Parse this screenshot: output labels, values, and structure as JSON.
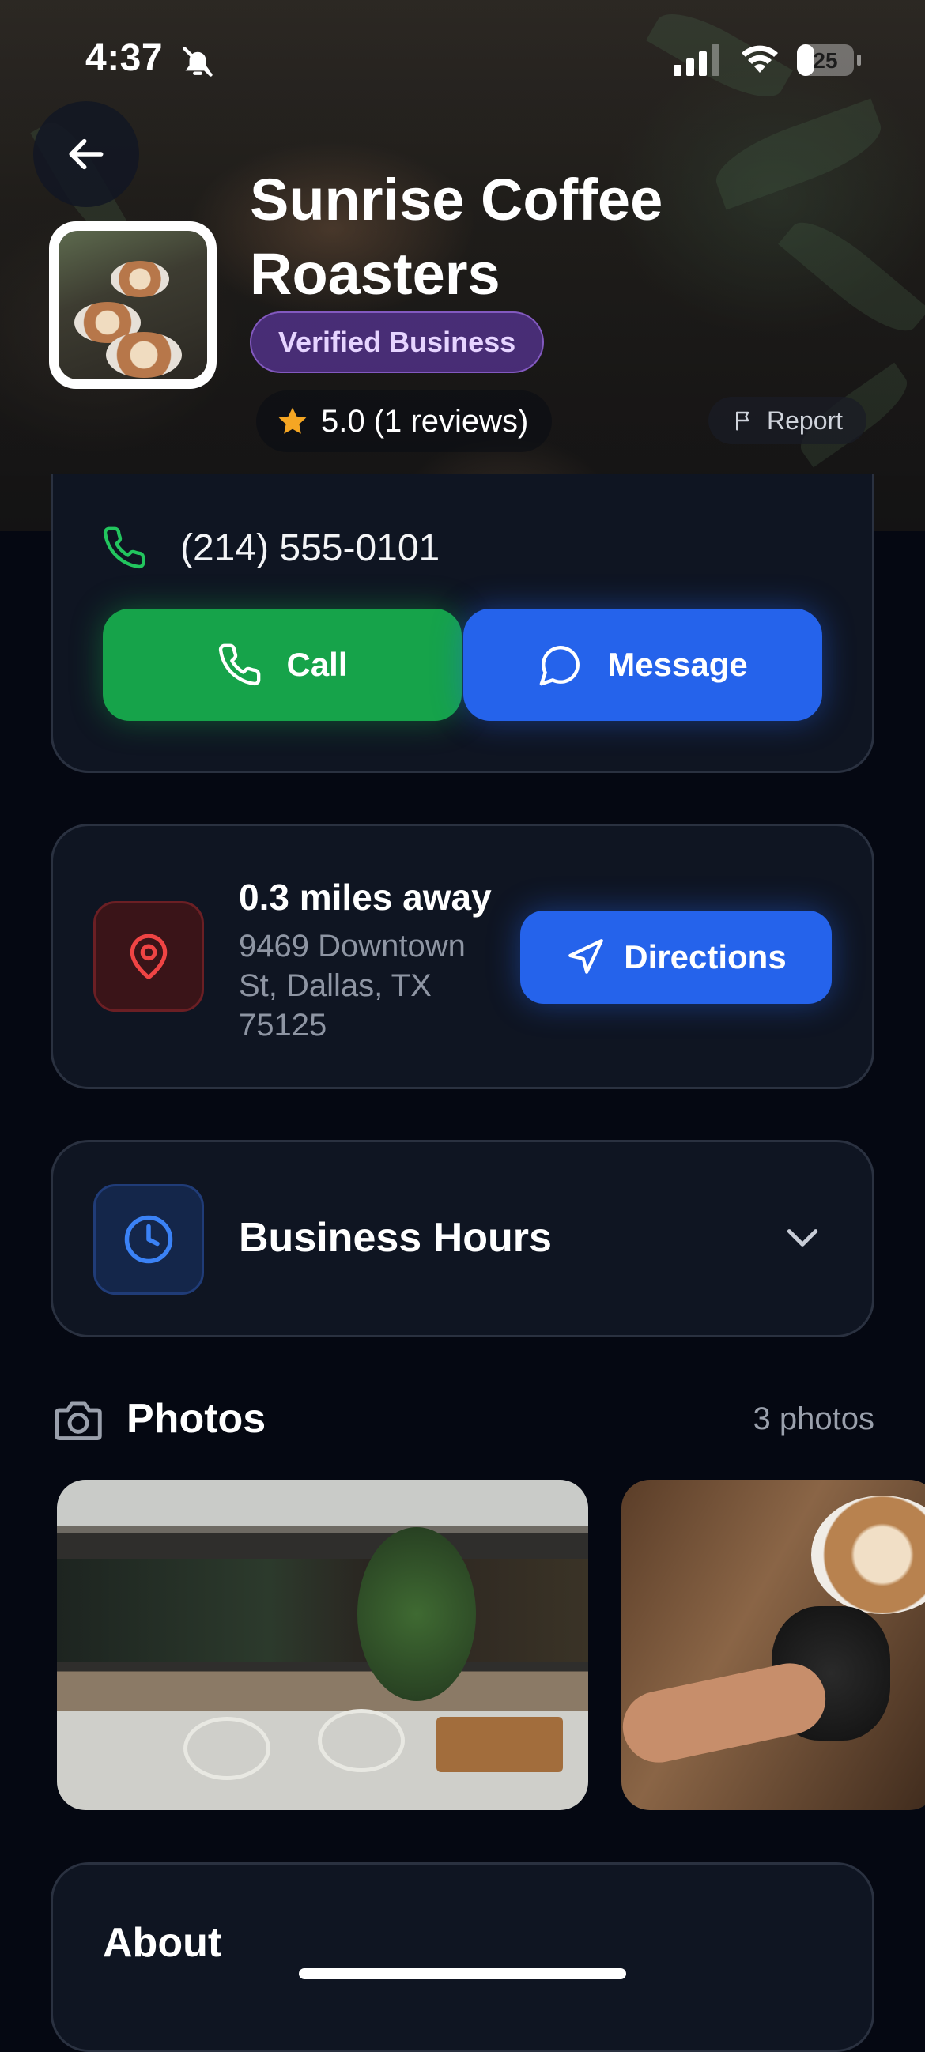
{
  "status_bar": {
    "time": "4:37",
    "battery": "25"
  },
  "header": {
    "business_name": "Sunrise Coffee Roasters",
    "verified_label": "Verified Business",
    "rating": "5.0 (1 reviews)",
    "report_label": "Report"
  },
  "contact": {
    "phone": "(214) 555-0101",
    "call_label": "Call",
    "message_label": "Message"
  },
  "location": {
    "distance": "0.3 miles away",
    "address": "9469 Downtown St, Dallas, TX 75125",
    "directions_label": "Directions"
  },
  "hours": {
    "label": "Business Hours"
  },
  "photos": {
    "title": "Photos",
    "count": "3 photos"
  },
  "about": {
    "title": "About"
  },
  "colors": {
    "background": "#050812",
    "card": "#0f1522",
    "call_green": "#16a34a",
    "primary_blue": "#2563eb",
    "verified_purple": "#583496",
    "star": "#f5a623",
    "pin_red": "#ef4444"
  },
  "icons": [
    "back-arrow-icon",
    "bell-off-icon",
    "signal-icon",
    "wifi-icon",
    "battery-icon",
    "star-icon",
    "flag-icon",
    "phone-icon",
    "message-icon",
    "map-pin-icon",
    "navigation-icon",
    "clock-icon",
    "chevron-down-icon",
    "camera-icon"
  ]
}
